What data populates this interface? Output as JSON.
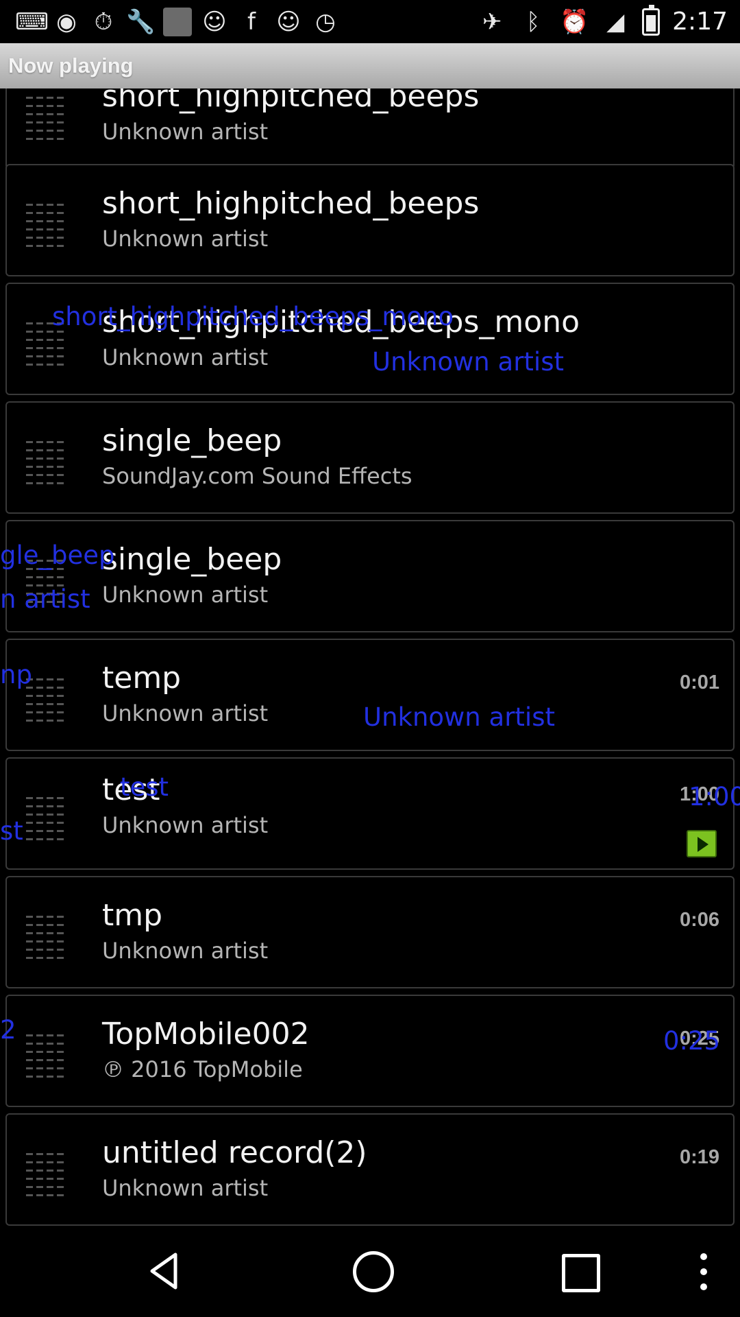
{
  "status_bar": {
    "time": "2:17",
    "icons": [
      "keyboard-icon",
      "record-icon",
      "stopwatch-icon",
      "wrench-icon",
      "app-square-icon",
      "smiley-icon",
      "facebook-icon",
      "smiley-icon",
      "clock-icon",
      "fake-gps-icon",
      "bluetooth-icon",
      "alarm-icon",
      "signal-icon",
      "battery-icon"
    ]
  },
  "title_bar": {
    "title": "Now playing"
  },
  "tracks": [
    {
      "title": "short_highpitched_beeps",
      "artist": "Unknown artist",
      "duration": ""
    },
    {
      "title": "short_highpitched_beeps",
      "artist": "Unknown artist",
      "duration": ""
    },
    {
      "title": "short_highpitched_beeps_mono",
      "artist": "Unknown artist",
      "duration": ""
    },
    {
      "title": "single_beep",
      "artist": "SoundJay.com Sound Effects",
      "duration": ""
    },
    {
      "title": "single_beep",
      "artist": "Unknown artist",
      "duration": ""
    },
    {
      "title": "temp",
      "artist": "Unknown artist",
      "duration": "0:01"
    },
    {
      "title": "test",
      "artist": "Unknown artist",
      "duration": "1:00",
      "playing": true
    },
    {
      "title": "tmp",
      "artist": "Unknown artist",
      "duration": "0:06"
    },
    {
      "title": "TopMobile002",
      "artist": "℗ 2016 TopMobile",
      "duration": "0:25"
    },
    {
      "title": "untitled record(2)",
      "artist": "Unknown artist",
      "duration": "0:19"
    }
  ],
  "overlays": {
    "o1": "short_highpitched_beeps_mono",
    "o2": "Unknown artist",
    "o3": "gle_beep",
    "o4": "n artist",
    "o5": "np",
    "o6": "Unknown artist",
    "o7": "test",
    "o8": "1:00",
    "o9": "st",
    "o10": "2",
    "o11": "0:25"
  },
  "accent_colors": {
    "play": "#7cc220",
    "overlay_text": "#2230e0",
    "title_bar": "#bdbdbd"
  },
  "nav": [
    "back-icon",
    "home-icon",
    "recents-icon",
    "more-icon"
  ]
}
